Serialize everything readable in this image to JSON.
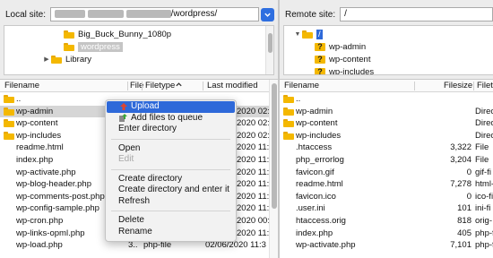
{
  "left": {
    "site_label": "Local site:",
    "path_suffix": "/wordpress/",
    "tree": [
      {
        "name": "Big_Buck_Bunny_1080p",
        "has_arrow": false,
        "selected": false
      },
      {
        "name": "wordpress",
        "has_arrow": false,
        "selected": true
      },
      {
        "name": "Library",
        "has_arrow": true,
        "selected": false
      }
    ],
    "columns": {
      "filename": "Filename",
      "filesize": "File",
      "filetype": "Filetype",
      "modified": "Last modified"
    },
    "files": [
      {
        "name": "..",
        "folder": true,
        "size": "",
        "type": "",
        "modified": ""
      },
      {
        "name": "wp-admin",
        "folder": true,
        "size": "",
        "type": "",
        "modified": "2020 02:4",
        "selected": true
      },
      {
        "name": "wp-content",
        "folder": true,
        "size": "",
        "type": "",
        "modified": "2020 02:4"
      },
      {
        "name": "wp-includes",
        "folder": true,
        "size": "",
        "type": "",
        "modified": "2020 02:4"
      },
      {
        "name": "readme.html",
        "folder": false,
        "size": "",
        "type": "",
        "modified": "2020 11:3"
      },
      {
        "name": "index.php",
        "folder": false,
        "size": "",
        "type": "",
        "modified": "2020 11:3"
      },
      {
        "name": "wp-activate.php",
        "folder": false,
        "size": "",
        "type": "",
        "modified": "2020 11:3"
      },
      {
        "name": "wp-blog-header.php",
        "folder": false,
        "size": "",
        "type": "",
        "modified": "2020 11:3"
      },
      {
        "name": "wp-comments-post.php",
        "folder": false,
        "size": "",
        "type": "",
        "modified": "2020 11:3"
      },
      {
        "name": "wp-config-sample.php",
        "folder": false,
        "size": "",
        "type": "",
        "modified": "2020 11:3"
      },
      {
        "name": "wp-cron.php",
        "folder": false,
        "size": "",
        "type": "",
        "modified": "2020 00:1"
      },
      {
        "name": "wp-links-opml.php",
        "folder": false,
        "size": "",
        "type": "",
        "modified": "2020 11:3"
      },
      {
        "name": "wp-load.php",
        "folder": false,
        "size": "3..",
        "type": "php-file",
        "modified": "02/06/2020 11:3"
      }
    ]
  },
  "right": {
    "site_label": "Remote site:",
    "path": "/",
    "tree": [
      {
        "name": "/",
        "kind": "root"
      },
      {
        "name": "wp-admin",
        "kind": "unknown"
      },
      {
        "name": "wp-content",
        "kind": "unknown"
      },
      {
        "name": "wp-includes",
        "kind": "unknown"
      }
    ],
    "columns": {
      "filename": "Filename",
      "filesize": "Filesize",
      "filetype": "Filet"
    },
    "files": [
      {
        "name": "..",
        "folder": true,
        "size": "",
        "type": ""
      },
      {
        "name": "wp-admin",
        "folder": true,
        "size": "",
        "type": "Direc"
      },
      {
        "name": "wp-content",
        "folder": true,
        "size": "",
        "type": "Direc"
      },
      {
        "name": "wp-includes",
        "folder": true,
        "size": "",
        "type": "Direc"
      },
      {
        "name": ".htaccess",
        "folder": false,
        "size": "3,322",
        "type": "File"
      },
      {
        "name": "php_errorlog",
        "folder": false,
        "size": "3,204",
        "type": "File"
      },
      {
        "name": "favicon.gif",
        "folder": false,
        "size": "0",
        "type": "gif-fi"
      },
      {
        "name": "readme.html",
        "folder": false,
        "size": "7,278",
        "type": "html-"
      },
      {
        "name": "favicon.ico",
        "folder": false,
        "size": "0",
        "type": "ico-fi"
      },
      {
        "name": ".user.ini",
        "folder": false,
        "size": "101",
        "type": "ini-fi"
      },
      {
        "name": "htaccess.orig",
        "folder": false,
        "size": "818",
        "type": "orig-"
      },
      {
        "name": "index.php",
        "folder": false,
        "size": "405",
        "type": "php-fi"
      },
      {
        "name": "wp-activate.php",
        "folder": false,
        "size": "7,101",
        "type": "php-fi"
      }
    ]
  },
  "context_menu": {
    "items": [
      {
        "label": "Upload",
        "icon": "upload-arrow-icon",
        "highlight": true
      },
      {
        "label": "Add files to queue",
        "icon": "add-queue-icon"
      },
      {
        "label": "Enter directory"
      },
      {
        "sep": true
      },
      {
        "label": "Open"
      },
      {
        "label": "Edit",
        "disabled": true
      },
      {
        "sep": true
      },
      {
        "label": "Create directory"
      },
      {
        "label": "Create directory and enter it"
      },
      {
        "label": "Refresh"
      },
      {
        "sep": true
      },
      {
        "label": "Delete"
      },
      {
        "label": "Rename"
      }
    ]
  },
  "colors": {
    "accent": "#2e69d9",
    "folder": "#f4b800",
    "selection": "#d6d6d6"
  }
}
